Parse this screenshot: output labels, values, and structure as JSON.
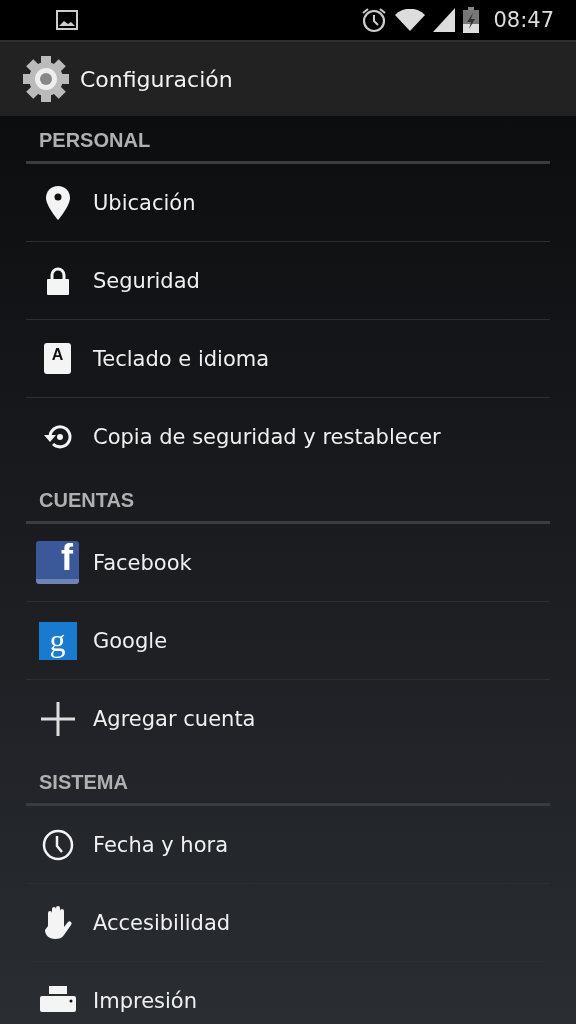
{
  "status_bar": {
    "time": "08:47"
  },
  "action_bar": {
    "title": "Configuración"
  },
  "sections": [
    {
      "title": "PERSONAL",
      "items": [
        {
          "label": "Ubicación",
          "kind": "pin"
        },
        {
          "label": "Seguridad",
          "kind": "lock"
        },
        {
          "label": "Teclado e idioma",
          "kind": "keyboard",
          "badge": "A"
        },
        {
          "label": "Copia de seguridad y restablecer",
          "kind": "restore"
        }
      ]
    },
    {
      "title": "CUENTAS",
      "items": [
        {
          "label": "Facebook",
          "kind": "facebook",
          "badge": "f"
        },
        {
          "label": "Google",
          "kind": "google",
          "badge": "g"
        },
        {
          "label": "Agregar cuenta",
          "kind": "plus"
        }
      ]
    },
    {
      "title": "SISTEMA",
      "items": [
        {
          "label": "Fecha y hora",
          "kind": "clock"
        },
        {
          "label": "Accesibilidad",
          "kind": "hand"
        },
        {
          "label": "Impresión",
          "kind": "printer"
        }
      ]
    }
  ]
}
